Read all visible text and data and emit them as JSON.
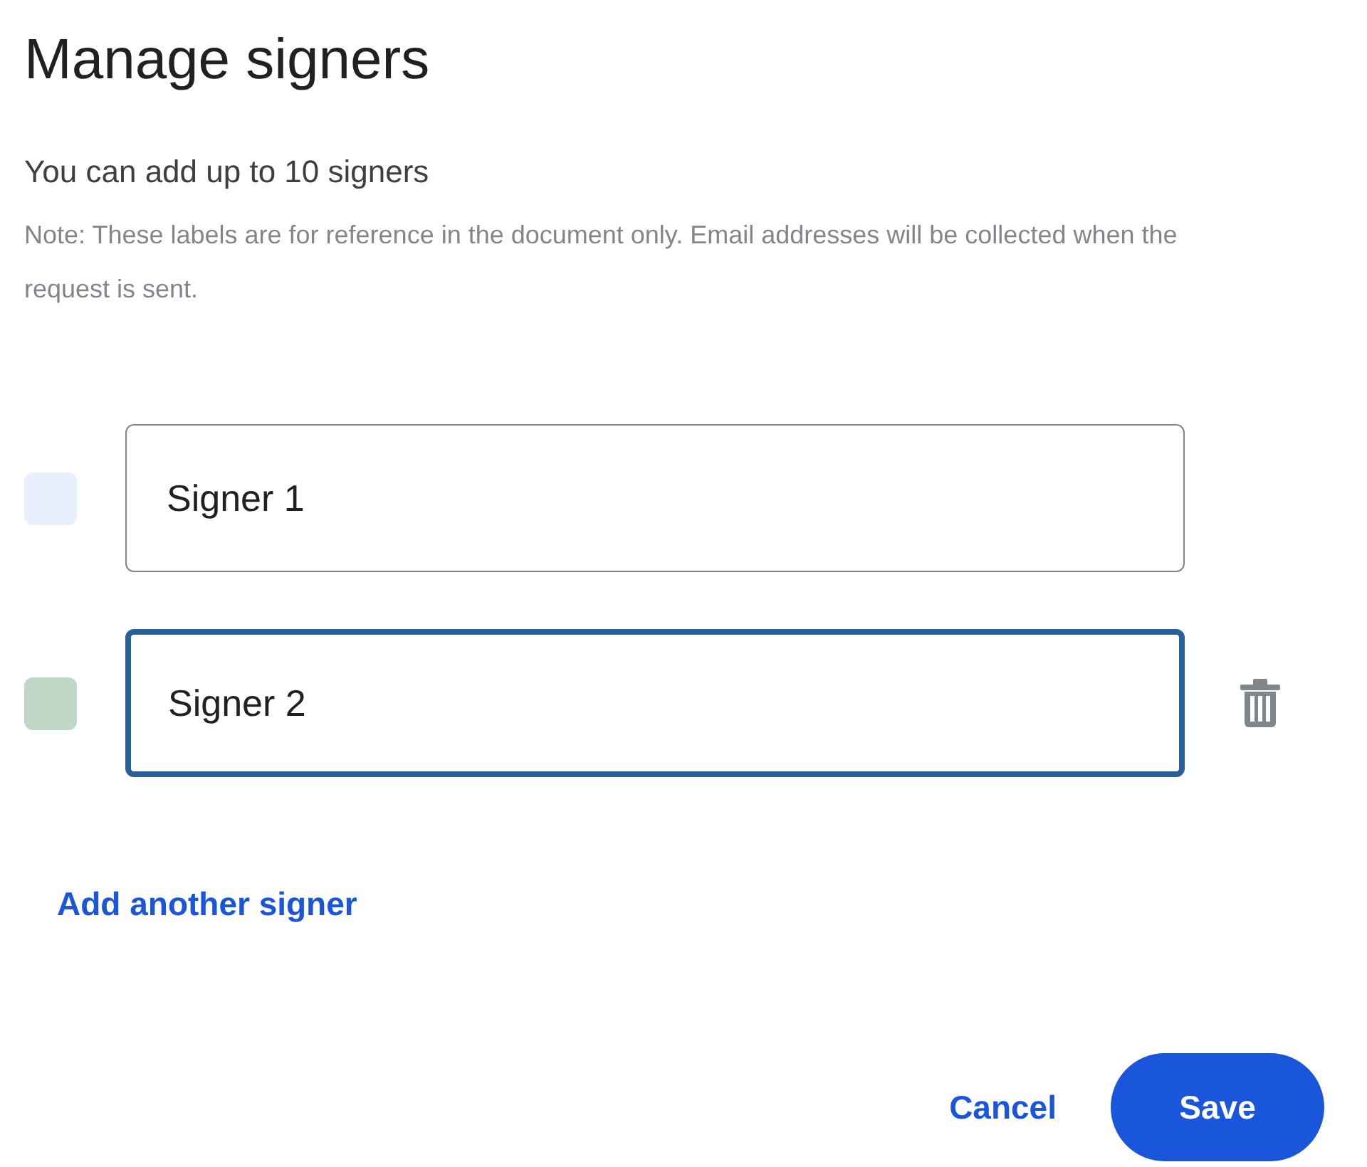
{
  "dialog": {
    "title": "Manage signers",
    "subtitle": "You can add up to 10 signers",
    "note": "Note: These labels are for reference in the document only. Email addresses will be collected when the request is sent."
  },
  "signers": [
    {
      "value": "Signer 1",
      "color": "#e8f0fe",
      "focused": false,
      "deletable": false
    },
    {
      "value": "Signer 2",
      "color": "#bfd8c6",
      "focused": true,
      "deletable": true
    }
  ],
  "add_link": "Add another signer",
  "buttons": [
    {
      "label": "Cancel",
      "kind": "text"
    },
    {
      "label": "Save",
      "kind": "filled"
    }
  ]
}
